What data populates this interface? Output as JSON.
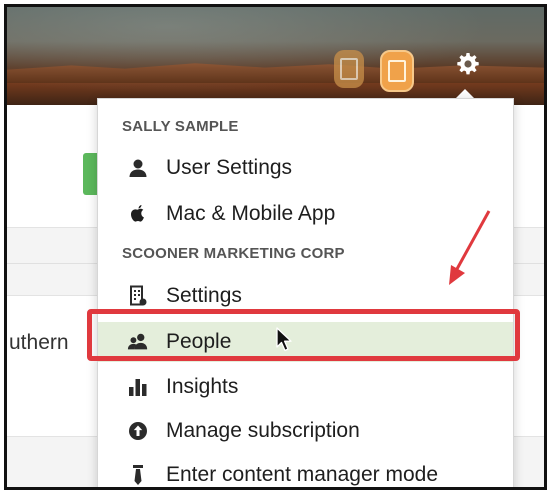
{
  "header": {
    "icons": [
      "calendar-badge-icon",
      "calendar-badge-icon",
      "gear-icon"
    ]
  },
  "background": {
    "visible_text": "uthern"
  },
  "menu": {
    "user_section": "SALLY SAMPLE",
    "user_items": [
      {
        "label": "User Settings",
        "icon": "user-icon"
      },
      {
        "label": "Mac & Mobile App",
        "icon": "apple-icon"
      }
    ],
    "org_section": "SCOONER MARKETING CORP",
    "org_items": [
      {
        "label": "Settings",
        "icon": "building-icon"
      },
      {
        "label": "People",
        "icon": "people-icon",
        "highlighted": true
      },
      {
        "label": "Insights",
        "icon": "bar-chart-icon"
      },
      {
        "label": "Manage subscription",
        "icon": "upload-circle-icon"
      },
      {
        "label": "Enter content manager mode",
        "icon": "tie-icon"
      }
    ]
  },
  "annotations": {
    "highlight_color": "#e0393e",
    "active_row_color": "#e4eedb"
  }
}
